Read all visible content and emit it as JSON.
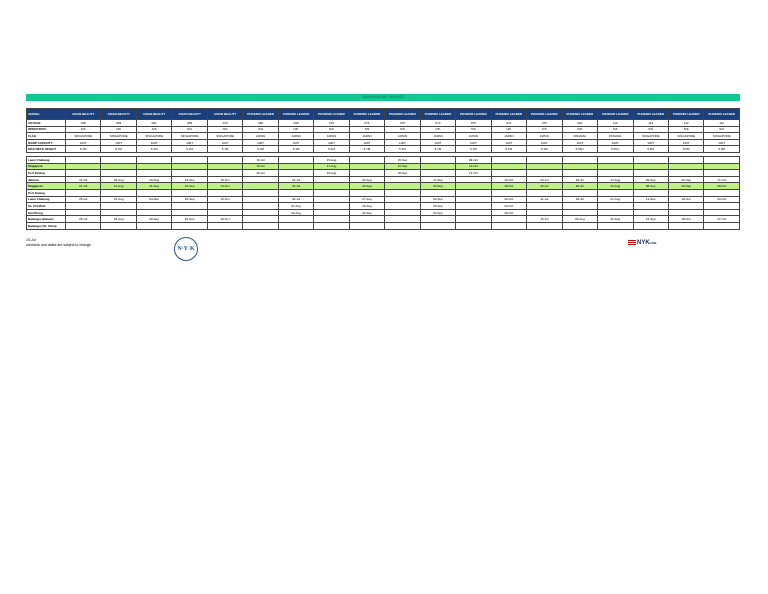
{
  "title": "SEA PARADISE SERVICE",
  "upper": {
    "header_label": "VESSEL",
    "vessels": [
      "ASIAN BEAUTY",
      "ASIAN BEAUTY",
      "ASIAN BEAUTY",
      "ASIAN BEAUTY",
      "ASIAN BEAUTY",
      "PHOENIX LEADER",
      "PHOENIX LEADER",
      "PHOENIX LEADER",
      "PHOENIX LEADER",
      "PHOENIX LEADER",
      "PHOENIX LEADER",
      "PHOENIX LEADER",
      "PHOENIX LEADER",
      "PHOENIX LEADER",
      "PHOENIX LEADER",
      "PHOENIX LEADER",
      "PHOENIX LEADER",
      "PHOENIX LEADER",
      "PHOENIX LEADER"
    ],
    "rows": [
      {
        "label": "VOYAGE",
        "cells": [
          "038",
          "053",
          "061",
          "059",
          "070",
          "080",
          "068",
          "075",
          "075",
          "075",
          "073",
          "075",
          "074",
          "075",
          "020",
          "112",
          "113",
          "112",
          "112"
        ]
      },
      {
        "label": "OPERATION",
        "cells": [
          "N/K",
          "N/K",
          "S/S",
          "N/K",
          "N/K",
          "S/S",
          "N/K",
          "N/K",
          "S/S",
          "S/S",
          "N/K",
          "S/S",
          "N/K",
          "S/S",
          "N/K",
          "S/S",
          "S/S",
          "N/K",
          "S/S"
        ]
      },
      {
        "label": "FLAG",
        "cells": [
          "SINGAPORE",
          "SINGAPORE",
          "SINGAPORE",
          "SINGAPORE",
          "SINGAPORE",
          "JAPAN",
          "JAPAN",
          "JAPAN",
          "JAPAN",
          "JAPAN",
          "JAPAN",
          "JAPAN",
          "JAPAN",
          "JAPAN",
          "PANAMA",
          "PANAMA",
          "SINGAPORE",
          "SINGAPORE",
          "SINGAPORE"
        ]
      },
      {
        "label": "RAMP CAPACITY",
        "cells": [
          "100T",
          "100T",
          "100T",
          "100T",
          "100T",
          "100T",
          "100T",
          "100T",
          "100T",
          "100T",
          "100T",
          "100T",
          "100T",
          "100T",
          "100T",
          "100T",
          "100T",
          "100T",
          "100T"
        ]
      },
      {
        "label": "MAX DECK HEIGHT",
        "cells": [
          "5.1M",
          "5.1M",
          "5.1M",
          "5.1M",
          "5.1M",
          "5.1M",
          "5.1M",
          "5.1M",
          "5.1M",
          "5.1M",
          "5.1M",
          "5.1M",
          "5.1M",
          "5.1M",
          "5.65m",
          "5.65m",
          "5.0M",
          "5.0M",
          "5.0M"
        ]
      }
    ]
  },
  "lower": {
    "rows": [
      {
        "label": "Laem Chabang",
        "green": false,
        "cells": [
          "",
          "",
          "",
          "",
          "",
          "16-Jul",
          "",
          "15-Aug",
          "",
          "15-Sep",
          "",
          "09-Oct",
          "",
          "",
          "",
          "",
          "",
          "",
          ""
        ]
      },
      {
        "label": "Singapore",
        "green": true,
        "cells": [
          "",
          "",
          "",
          "",
          "",
          "18-Jul",
          "",
          "17-Aug",
          "",
          "16-Sep",
          "",
          "11-Oct",
          "",
          "",
          "",
          "",
          "",
          "",
          ""
        ]
      },
      {
        "label": "Port Kelang",
        "green": false,
        "cells": [
          "",
          "",
          "",
          "",
          "",
          "20-Jul",
          "",
          "19-Aug",
          "",
          "18-Sep",
          "",
          "13-Oct",
          "",
          "",
          "",
          "",
          "",
          "",
          ""
        ]
      },
      {
        "label": "Jakarta",
        "green": false,
        "cells": [
          "16-Jul",
          "09-Aug",
          "29-Aug",
          "19-Sep",
          "10-Oct",
          "",
          "22-Jul",
          "",
          "20-Aug",
          "",
          "17-Sep",
          "",
          "15-Oct",
          "20-Jul",
          "26-Jul",
          "13-Aug",
          "09-Sep",
          "26-Sep",
          "17-Oct"
        ]
      },
      {
        "label": "Singapore",
        "green": true,
        "cells": [
          "21-Jul",
          "11-Aug",
          "31-Aug",
          "22-Sep",
          "13-Oct",
          "",
          "26-Jul",
          "",
          "23-Aug",
          "",
          "20-Sep",
          "",
          "18-Oct",
          "26-Jul",
          "28-Jul",
          "16-Aug",
          "08-Sep",
          "29-Sep",
          "20-Oct"
        ]
      },
      {
        "label": "Port Kelang",
        "green": false,
        "cells": [
          "",
          "",
          "",
          "",
          "",
          "",
          "",
          "",
          "",
          "",
          "",
          "",
          "",
          "",
          "",
          "",
          "",
          "",
          ""
        ]
      },
      {
        "label": "Laem Chabang",
        "green": false,
        "cells": [
          "25-Jul",
          "15-Aug",
          "04-Sep",
          "25-Sep",
          "16-Oct",
          "",
          "30-Jul",
          "",
          "27-Aug",
          "",
          "24-Sep",
          "",
          "22-Oct",
          "11-Jul",
          "30-Jul",
          "21-Aug",
          "11-Sep",
          "02-Oct",
          "23-Oct"
        ]
      },
      {
        "label": "Ho Chi Minh",
        "green": false,
        "cells": [
          "",
          "",
          "",
          "",
          "",
          "",
          "01-Aug",
          "",
          "29-Aug",
          "",
          "26-Sep",
          "",
          "24-Oct",
          "",
          "",
          "",
          "",
          "",
          ""
        ]
      },
      {
        "label": "Hai Phong",
        "green": false,
        "cells": [
          "",
          "",
          "",
          "",
          "",
          "",
          "03-Aug",
          "",
          "02-Sep",
          "",
          "30-Sep",
          "",
          "28-Oct",
          "",
          "",
          "",
          "",
          "",
          ""
        ]
      },
      {
        "label": "Batangas (Bauan)",
        "green": false,
        "cells": [
          "28-Jul",
          "18-Aug",
          "08-Sep",
          "29-Sep",
          "20-Oct",
          "",
          "",
          "",
          "",
          "",
          "",
          "",
          "",
          "15-Jul",
          "03-Aug",
          "25-Aug",
          "15-Sep",
          "06-Oct",
          "27-Oct"
        ]
      },
      {
        "label": "Batangas (St. Clara)",
        "green": false,
        "cells": [
          "",
          "",
          "",
          "",
          "",
          "",
          "",
          "",
          "",
          "",
          "",
          "",
          "",
          "",
          "",
          "",
          "",
          "",
          ""
        ]
      }
    ]
  },
  "footer": {
    "date": "15-Jul",
    "note": "schedule and dates are subject to change"
  },
  "logos": {
    "emblem": "NYK",
    "brand": "NYK LINE"
  }
}
